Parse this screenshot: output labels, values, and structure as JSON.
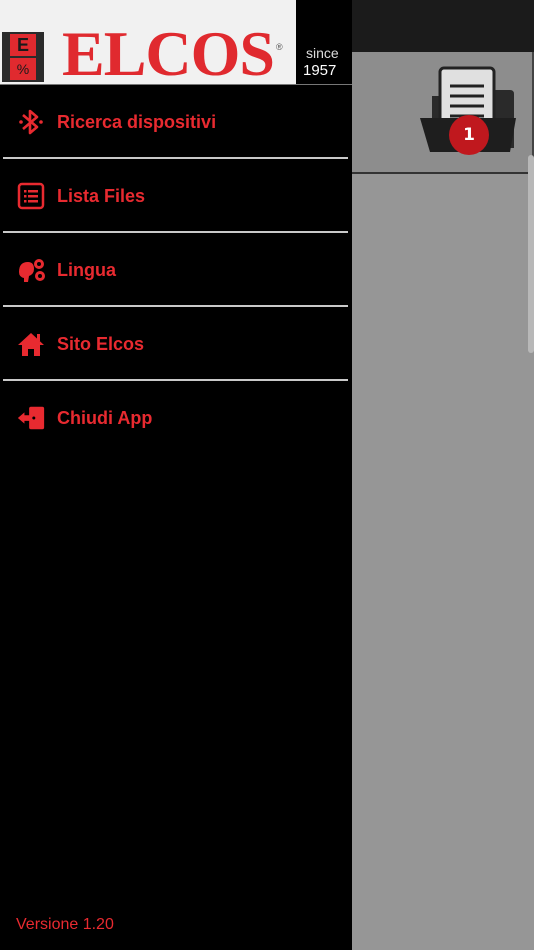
{
  "brand": {
    "logo_text": "ELCOS",
    "logo_letter": "E",
    "logo_symbol": "%",
    "registered": "®",
    "since_label": "since",
    "since_year": "1957",
    "color": "#e02a2f"
  },
  "menu": [
    {
      "label": "Ricerca dispositivi",
      "icon": "bluetooth-icon"
    },
    {
      "label": "Lista Files",
      "icon": "list-icon"
    },
    {
      "label": "Lingua",
      "icon": "language-icon"
    },
    {
      "label": "Sito Elcos",
      "icon": "home-icon"
    },
    {
      "label": "Chiudi App",
      "icon": "exit-icon"
    }
  ],
  "version": "Versione 1.20",
  "files_badge": {
    "count": "1",
    "icon": "file-folder-icon"
  }
}
